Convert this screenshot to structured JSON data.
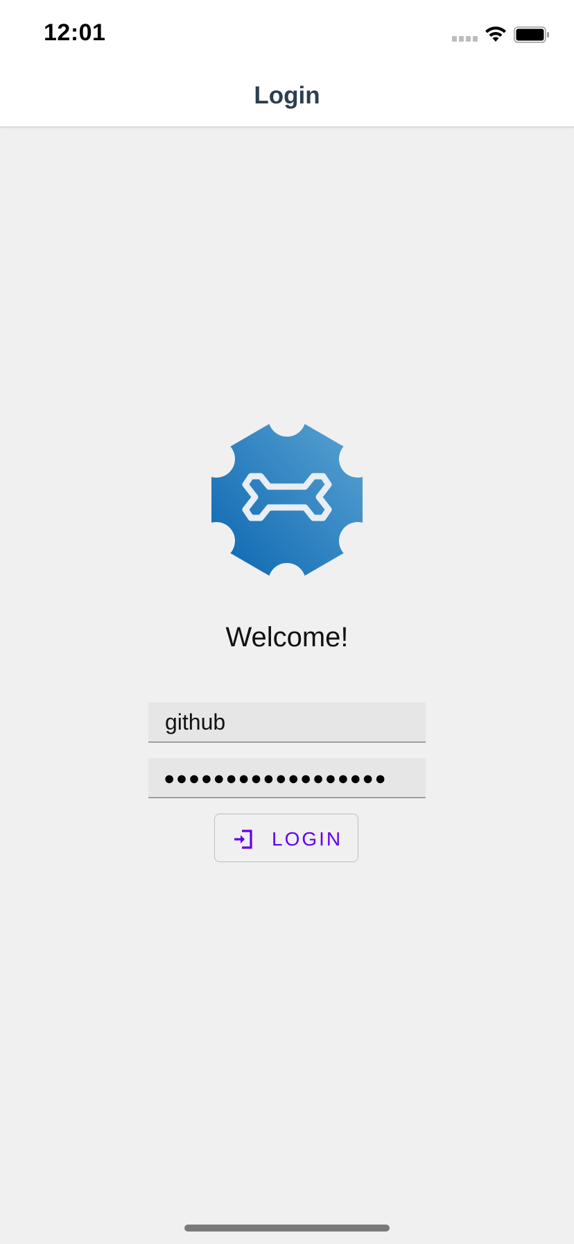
{
  "status_bar": {
    "time": "12:01"
  },
  "nav": {
    "title": "Login"
  },
  "logo": {
    "icon": "gear-bone-logo",
    "color": "#2a7fc0"
  },
  "welcome": {
    "text": "Welcome!"
  },
  "form": {
    "username": {
      "value": "github",
      "placeholder": ""
    },
    "password": {
      "masked_value": "●●●●●●●●●●●●●●●●●●"
    },
    "login_button": {
      "label": "LOGIN",
      "icon": "login-icon",
      "color": "#6200ee"
    }
  },
  "colors": {
    "background": "#f0f0f0",
    "nav_title": "#2c3e50",
    "accent": "#6200ee"
  }
}
